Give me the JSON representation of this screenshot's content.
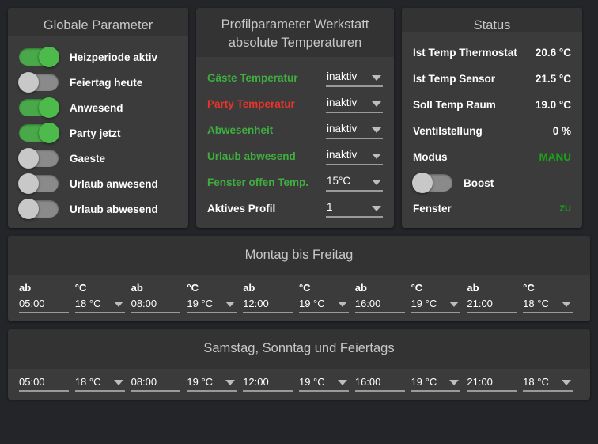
{
  "panels": {
    "global": {
      "title": "Globale Parameter",
      "switches": [
        {
          "label": "Heizperiode aktiv",
          "state": "on"
        },
        {
          "label": "Feiertag heute",
          "state": "off"
        },
        {
          "label": "Anwesend",
          "state": "on"
        },
        {
          "label": "Party jetzt",
          "state": "on"
        },
        {
          "label": "Gaeste",
          "state": "off"
        },
        {
          "label": "Urlaub anwesend",
          "state": "off"
        },
        {
          "label": "Urlaub abwesend",
          "state": "off"
        }
      ]
    },
    "profile": {
      "title_line1": "Profilparameter Werkstatt",
      "title_line2": "absolute Temperaturen",
      "rows": [
        {
          "label": "Gäste Temperatur",
          "color": "green",
          "value": "inaktiv"
        },
        {
          "label": "Party Temperatur",
          "color": "red",
          "value": "inaktiv"
        },
        {
          "label": "Abwesenheit",
          "color": "green",
          "value": "inaktiv"
        },
        {
          "label": "Urlaub abwesend",
          "color": "green",
          "value": "inaktiv"
        },
        {
          "label": "Fenster offen Temp.",
          "color": "green",
          "value": "15°C"
        },
        {
          "label": "Aktives Profil",
          "color": "white",
          "value": "1"
        }
      ]
    },
    "status": {
      "title": "Status",
      "rows": [
        {
          "label": "Ist Temp Thermostat",
          "value": "20.6 °C",
          "color": "white",
          "size": "normal"
        },
        {
          "label": "Ist Temp Sensor",
          "value": "21.5 °C",
          "color": "white",
          "size": "normal"
        },
        {
          "label": "Soll Temp Raum",
          "value": "19.0 °C",
          "color": "white",
          "size": "normal"
        },
        {
          "label": "Ventilstellung",
          "value": "0 %",
          "color": "white",
          "size": "normal"
        },
        {
          "label": "Modus",
          "value": "MANU",
          "color": "green",
          "size": "normal"
        }
      ],
      "boost": {
        "label": "Boost",
        "state": "off"
      },
      "window": {
        "label": "Fenster",
        "value": "ZU",
        "color": "green",
        "size": "small"
      }
    },
    "weekday_schedule": {
      "title": "Montag bis Freitag",
      "show_headers": true,
      "header_time": "ab",
      "header_temp": "°C",
      "entries": [
        {
          "time": "05:00",
          "temp": "18 °C"
        },
        {
          "time": "08:00",
          "temp": "19 °C"
        },
        {
          "time": "12:00",
          "temp": "19 °C"
        },
        {
          "time": "16:00",
          "temp": "19 °C"
        },
        {
          "time": "21:00",
          "temp": "18 °C"
        }
      ]
    },
    "weekend_schedule": {
      "title": "Samstag, Sonntag und Feiertags",
      "show_headers": false,
      "header_time": "",
      "header_temp": "",
      "entries": [
        {
          "time": "05:00",
          "temp": "18 °C"
        },
        {
          "time": "08:00",
          "temp": "19 °C"
        },
        {
          "time": "12:00",
          "temp": "19 °C"
        },
        {
          "time": "16:00",
          "temp": "19 °C"
        },
        {
          "time": "21:00",
          "temp": "18 °C"
        }
      ]
    }
  },
  "colors": {
    "page_background": "#232529",
    "panel_background": "#3b3b3b",
    "panel_header": "#333333",
    "accent_green": "#4cbb4c",
    "accent_red": "#e8342b",
    "status_green": "#19a319",
    "text_white": "#ffffff",
    "text_muted": "#c7c7c7",
    "underline": "#9a9a9a"
  }
}
